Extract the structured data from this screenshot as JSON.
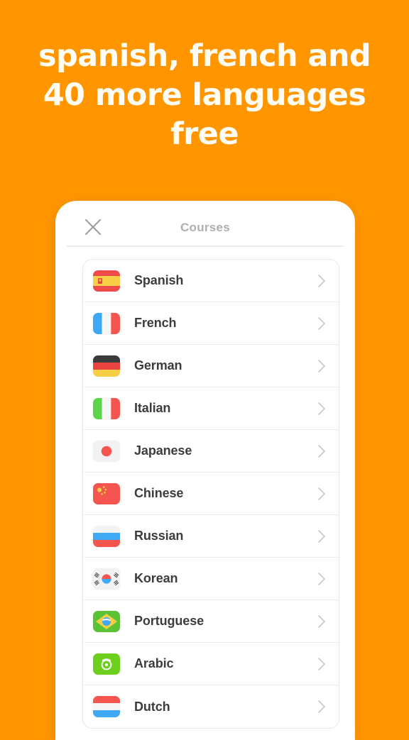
{
  "theme": {
    "background_color": "#FF9600",
    "headline_color": "#FFFDF5",
    "card_color": "#FFFFFF",
    "label_color": "#3C3C3C",
    "muted_color": "#AFAFAF"
  },
  "headline": {
    "text": "spanish, french and 40 more languages free"
  },
  "phone": {
    "header": {
      "close_icon": "close-icon",
      "title": "Courses"
    },
    "courses": [
      {
        "label": "Spanish",
        "flag": "spain-flag",
        "chevron": "chevron-right-icon"
      },
      {
        "label": "French",
        "flag": "france-flag",
        "chevron": "chevron-right-icon"
      },
      {
        "label": "German",
        "flag": "germany-flag",
        "chevron": "chevron-right-icon"
      },
      {
        "label": "Italian",
        "flag": "italy-flag",
        "chevron": "chevron-right-icon"
      },
      {
        "label": "Japanese",
        "flag": "japan-flag",
        "chevron": "chevron-right-icon"
      },
      {
        "label": "Chinese",
        "flag": "china-flag",
        "chevron": "chevron-right-icon"
      },
      {
        "label": "Russian",
        "flag": "russia-flag",
        "chevron": "chevron-right-icon"
      },
      {
        "label": "Korean",
        "flag": "korea-flag",
        "chevron": "chevron-right-icon"
      },
      {
        "label": "Portuguese",
        "flag": "brazil-flag",
        "chevron": "chevron-right-icon"
      },
      {
        "label": "Arabic",
        "flag": "arabic-flag",
        "chevron": "chevron-right-icon"
      },
      {
        "label": "Dutch",
        "flag": "netherlands-flag",
        "chevron": "chevron-right-icon"
      }
    ]
  }
}
